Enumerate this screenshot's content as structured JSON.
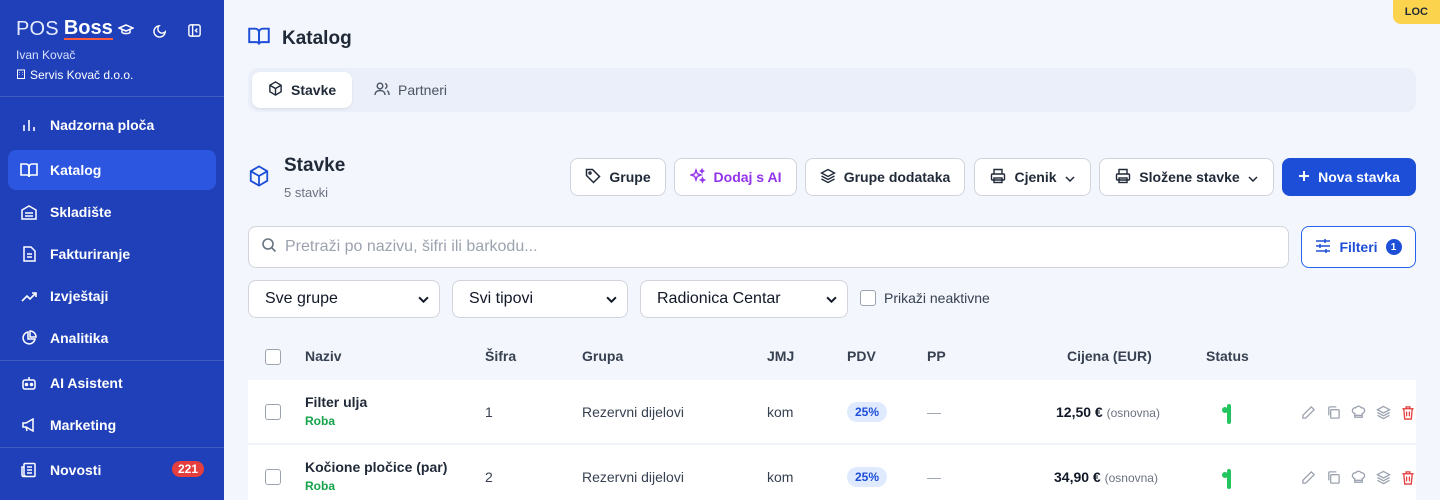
{
  "sidebar": {
    "brand_pos": "POS",
    "brand_boss": "Boss",
    "user_name": "Ivan Kovač",
    "company": "Servis Kovač d.o.o.",
    "items": [
      {
        "label": "Nadzorna ploča",
        "icon": "chart-bars-icon"
      },
      {
        "label": "Katalog",
        "icon": "book-icon",
        "active": true
      },
      {
        "label": "Skladište",
        "icon": "warehouse-icon"
      },
      {
        "label": "Fakturiranje",
        "icon": "document-icon"
      },
      {
        "label": "Izvještaji",
        "icon": "trending-icon"
      },
      {
        "label": "Analitika",
        "icon": "pie-icon"
      },
      {
        "label": "AI Asistent",
        "icon": "robot-icon"
      },
      {
        "label": "Marketing",
        "icon": "megaphone-icon"
      },
      {
        "label": "Novosti",
        "icon": "news-icon",
        "badge": "221"
      }
    ]
  },
  "env_badge": "LOC",
  "header": {
    "title": "Katalog"
  },
  "tabs": [
    {
      "label": "Stavke",
      "active": true
    },
    {
      "label": "Partneri",
      "active": false
    }
  ],
  "section": {
    "title": "Stavke",
    "subtitle": "5 stavki"
  },
  "toolbar": {
    "groups": "Grupe",
    "add_ai": "Dodaj s AI",
    "addon_groups": "Grupe dodataka",
    "pricelist": "Cjenik",
    "composite": "Složene stavke",
    "new_item": "Nova stavka"
  },
  "search": {
    "placeholder": "Pretraži po nazivu, šifri ili barkodu...",
    "value": ""
  },
  "filters": {
    "label": "Filteri",
    "count": "1",
    "group_select": "Sve grupe",
    "type_select": "Svi tipovi",
    "location_select": "Radionica Centar",
    "show_inactive": "Prikaži neaktivne"
  },
  "table": {
    "headers": {
      "name": "Naziv",
      "code": "Šifra",
      "group": "Grupa",
      "unit": "JMJ",
      "vat": "PDV",
      "pp": "PP",
      "price": "Cijena (EUR)",
      "status": "Status"
    },
    "rows": [
      {
        "name": "Filter ulja",
        "type": "Roba",
        "code": "1",
        "group": "Rezervni dijelovi",
        "unit": "kom",
        "vat": "25%",
        "pp": "—",
        "price": "12,50 €",
        "price_note": "(osnovna)",
        "active": true
      },
      {
        "name": "Kočione pločice (par)",
        "type": "Roba",
        "code": "2",
        "group": "Rezervni dijelovi",
        "unit": "kom",
        "vat": "25%",
        "pp": "—",
        "price": "34,90 €",
        "price_note": "(osnovna)",
        "active": true
      }
    ]
  },
  "colors": {
    "sidebar_bg": "#1f40b8",
    "primary": "#1d4ed8",
    "ai": "#9333ea",
    "success": "#22c55e",
    "danger": "#e53e3e"
  }
}
